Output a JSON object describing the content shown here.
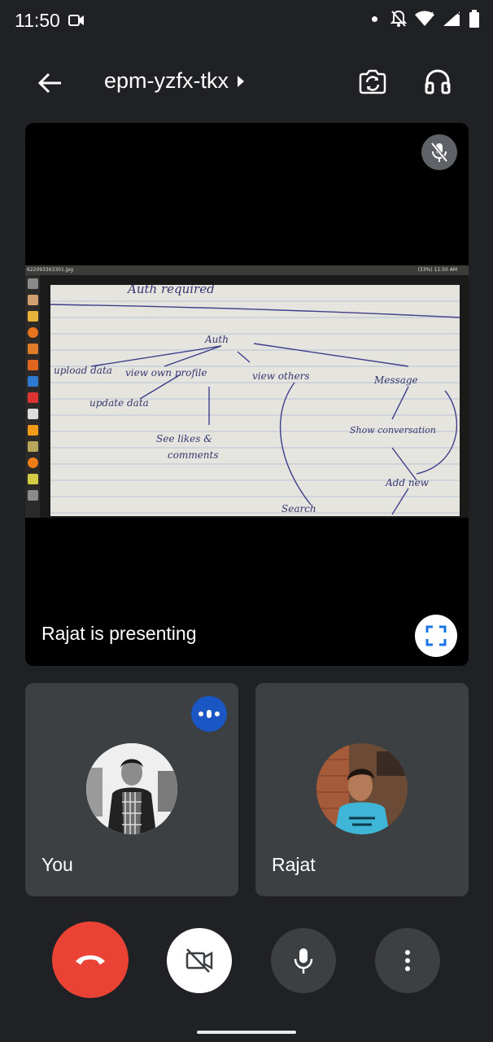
{
  "status_bar": {
    "time": "11:50"
  },
  "header": {
    "meeting_code": "epm-yzfx-tkx"
  },
  "presentation": {
    "presenting_label": "Rajat is presenting",
    "screen_filename": "622093363301.jpg",
    "screen_status": "(33%)  11:50 AM",
    "notes": {
      "line1": "Auth required",
      "auth": "Auth",
      "upload": "upload data",
      "view_own": "view own profile",
      "view_others": "view others",
      "message": "Message",
      "update": "update data",
      "see_likes": "See likes &",
      "comments": "comments",
      "show_conv": "Show conversation",
      "add_new": "Add new",
      "search": "Search"
    }
  },
  "participants": [
    {
      "name": "You"
    },
    {
      "name": "Rajat"
    }
  ],
  "controls": {
    "end_call": "end-call-icon",
    "camera": "video-off-icon",
    "mic": "mic-icon",
    "more": "more-vert-icon"
  },
  "colors": {
    "end_call": "#ea4335",
    "speaking": "#1a57c4",
    "tile": "#3c4043",
    "bg": "#202124"
  }
}
